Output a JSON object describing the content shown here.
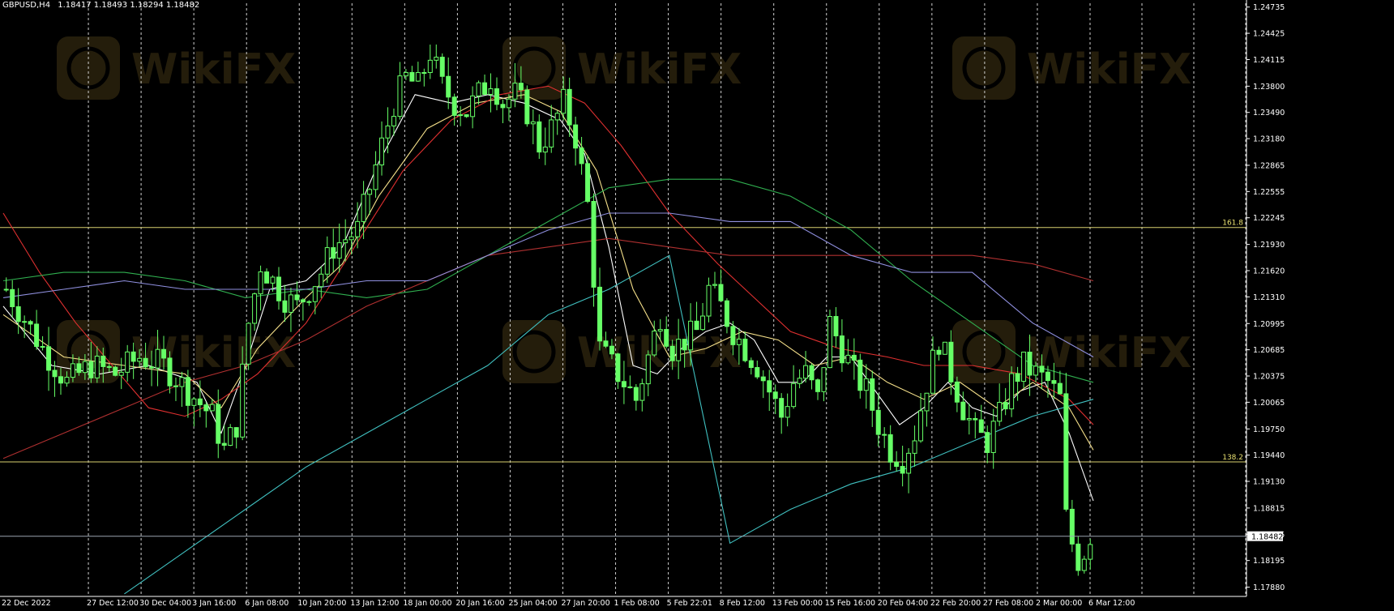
{
  "chart_data": {
    "type": "candlestick",
    "symbol": "GBPUSD,H4",
    "ohlc_readout": "1.18417 1.18493 1.18294 1.18482",
    "watermark": "WikiFX",
    "ylim": [
      1.1778,
      1.2478
    ],
    "y_ticks": [
      "1.24735",
      "1.24425",
      "1.24115",
      "1.23800",
      "1.23490",
      "1.23180",
      "1.22865",
      "1.22555",
      "1.22245",
      "1.21930",
      "1.21620",
      "1.21310",
      "1.20995",
      "1.20685",
      "1.20375",
      "1.20065",
      "1.19750",
      "1.19440",
      "1.19130",
      "1.18815",
      "1.18505",
      "1.18195",
      "1.17880"
    ],
    "x_ticks": [
      "22 Dec 2022",
      "27 Dec 12:00",
      "30 Dec 04:00",
      "3 Jan 16:00",
      "6 Jan 08:00",
      "10 Jan 20:00",
      "13 Jan 12:00",
      "18 Jan 00:00",
      "20 Jan 16:00",
      "25 Jan 04:00",
      "27 Jan 20:00",
      "1 Feb 08:00",
      "5 Feb 22:01",
      "8 Feb 12:00",
      "13 Feb 00:00",
      "15 Feb 16:00",
      "20 Feb 04:00",
      "22 Feb 20:00",
      "27 Feb 08:00",
      "2 Mar 00:00",
      "6 Mar 12:00"
    ],
    "current_price": "1.18482",
    "fibo_levels": [
      {
        "label": "161.8",
        "value": 1.2213
      },
      {
        "label": "138.2",
        "value": 1.1936
      }
    ],
    "close_path": [
      [
        0,
        1.214
      ],
      [
        6,
        1.207
      ],
      [
        10,
        1.203
      ],
      [
        14,
        1.205
      ],
      [
        18,
        1.204
      ],
      [
        22,
        1.206
      ],
      [
        26,
        1.205
      ],
      [
        30,
        1.202
      ],
      [
        34,
        1.199
      ],
      [
        36,
        1.195
      ],
      [
        38,
        1.198
      ],
      [
        40,
        1.21
      ],
      [
        42,
        1.217
      ],
      [
        44,
        1.215
      ],
      [
        46,
        1.213
      ],
      [
        48,
        1.212
      ],
      [
        50,
        1.214
      ],
      [
        52,
        1.216
      ],
      [
        54,
        1.219
      ],
      [
        56,
        1.22
      ],
      [
        58,
        1.221
      ],
      [
        60,
        1.226
      ],
      [
        62,
        1.231
      ],
      [
        64,
        1.236
      ],
      [
        66,
        1.239
      ],
      [
        68,
        1.238
      ],
      [
        70,
        1.242
      ],
      [
        72,
        1.238
      ],
      [
        74,
        1.236
      ],
      [
        76,
        1.235
      ],
      [
        78,
        1.237
      ],
      [
        80,
        1.239
      ],
      [
        82,
        1.236
      ],
      [
        84,
        1.237
      ],
      [
        86,
        1.235
      ],
      [
        88,
        1.231
      ],
      [
        90,
        1.233
      ],
      [
        92,
        1.236
      ],
      [
        94,
        1.232
      ],
      [
        96,
        1.224
      ],
      [
        98,
        1.207
      ],
      [
        100,
        1.205
      ],
      [
        102,
        1.203
      ],
      [
        104,
        1.201
      ],
      [
        106,
        1.206
      ],
      [
        108,
        1.211
      ],
      [
        110,
        1.207
      ],
      [
        112,
        1.208
      ],
      [
        114,
        1.209
      ],
      [
        116,
        1.214
      ],
      [
        118,
        1.212
      ],
      [
        120,
        1.209
      ],
      [
        122,
        1.207
      ],
      [
        124,
        1.205
      ],
      [
        126,
        1.202
      ],
      [
        128,
        1.199
      ],
      [
        130,
        1.203
      ],
      [
        132,
        1.204
      ],
      [
        134,
        1.201
      ],
      [
        136,
        1.21
      ],
      [
        138,
        1.207
      ],
      [
        140,
        1.204
      ],
      [
        142,
        1.202
      ],
      [
        144,
        1.198
      ],
      [
        146,
        1.195
      ],
      [
        148,
        1.194
      ],
      [
        150,
        1.197
      ],
      [
        152,
        1.203
      ],
      [
        154,
        1.208
      ],
      [
        156,
        1.204
      ],
      [
        158,
        1.2
      ],
      [
        160,
        1.197
      ],
      [
        162,
        1.196
      ],
      [
        164,
        1.199
      ],
      [
        166,
        1.203
      ],
      [
        168,
        1.205
      ],
      [
        170,
        1.204
      ],
      [
        172,
        1.203
      ],
      [
        174,
        1.201
      ],
      [
        175,
        1.187
      ],
      [
        176,
        1.184
      ],
      [
        177,
        1.182
      ],
      [
        178,
        1.183
      ],
      [
        179,
        1.185
      ]
    ],
    "ma_lines": [
      {
        "color": "#ffffff",
        "points": [
          [
            0,
            1.212
          ],
          [
            8,
            1.205
          ],
          [
            16,
            1.204
          ],
          [
            24,
            1.205
          ],
          [
            32,
            1.203
          ],
          [
            36,
            1.197
          ],
          [
            40,
            1.205
          ],
          [
            44,
            1.214
          ],
          [
            50,
            1.215
          ],
          [
            56,
            1.219
          ],
          [
            62,
            1.229
          ],
          [
            68,
            1.237
          ],
          [
            74,
            1.236
          ],
          [
            80,
            1.237
          ],
          [
            86,
            1.236
          ],
          [
            92,
            1.234
          ],
          [
            96,
            1.23
          ],
          [
            100,
            1.219
          ],
          [
            104,
            1.205
          ],
          [
            108,
            1.204
          ],
          [
            112,
            1.207
          ],
          [
            116,
            1.209
          ],
          [
            120,
            1.21
          ],
          [
            124,
            1.208
          ],
          [
            128,
            1.203
          ],
          [
            132,
            1.203
          ],
          [
            136,
            1.206
          ],
          [
            140,
            1.206
          ],
          [
            144,
            1.202
          ],
          [
            148,
            1.198
          ],
          [
            152,
            1.2
          ],
          [
            156,
            1.203
          ],
          [
            160,
            1.2
          ],
          [
            164,
            1.199
          ],
          [
            168,
            1.202
          ],
          [
            172,
            1.203
          ],
          [
            176,
            1.197
          ],
          [
            180,
            1.189
          ]
        ]
      },
      {
        "color": "#f5e08a",
        "points": [
          [
            0,
            1.211
          ],
          [
            10,
            1.206
          ],
          [
            20,
            1.205
          ],
          [
            30,
            1.204
          ],
          [
            36,
            1.2
          ],
          [
            42,
            1.207
          ],
          [
            50,
            1.213
          ],
          [
            56,
            1.217
          ],
          [
            62,
            1.225
          ],
          [
            70,
            1.233
          ],
          [
            78,
            1.236
          ],
          [
            86,
            1.237
          ],
          [
            92,
            1.235
          ],
          [
            98,
            1.228
          ],
          [
            104,
            1.214
          ],
          [
            110,
            1.206
          ],
          [
            116,
            1.207
          ],
          [
            122,
            1.209
          ],
          [
            128,
            1.208
          ],
          [
            134,
            1.205
          ],
          [
            140,
            1.206
          ],
          [
            146,
            1.203
          ],
          [
            152,
            1.201
          ],
          [
            158,
            1.203
          ],
          [
            164,
            1.2
          ],
          [
            170,
            1.203
          ],
          [
            176,
            1.2
          ],
          [
            180,
            1.195
          ]
        ]
      },
      {
        "color": "#e03030",
        "points": [
          [
            0,
            1.223
          ],
          [
            6,
            1.216
          ],
          [
            12,
            1.21
          ],
          [
            18,
            1.205
          ],
          [
            24,
            1.2
          ],
          [
            30,
            1.199
          ],
          [
            36,
            1.201
          ],
          [
            42,
            1.204
          ],
          [
            50,
            1.21
          ],
          [
            58,
            1.219
          ],
          [
            66,
            1.228
          ],
          [
            74,
            1.234
          ],
          [
            82,
            1.237
          ],
          [
            90,
            1.238
          ],
          [
            96,
            1.236
          ],
          [
            102,
            1.231
          ],
          [
            110,
            1.223
          ],
          [
            118,
            1.217
          ],
          [
            124,
            1.213
          ],
          [
            130,
            1.209
          ],
          [
            138,
            1.207
          ],
          [
            146,
            1.206
          ],
          [
            152,
            1.205
          ],
          [
            160,
            1.205
          ],
          [
            168,
            1.204
          ],
          [
            176,
            1.201
          ],
          [
            180,
            1.198
          ]
        ]
      },
      {
        "color": "#30b050",
        "points": [
          [
            0,
            1.215
          ],
          [
            10,
            1.216
          ],
          [
            20,
            1.216
          ],
          [
            30,
            1.215
          ],
          [
            40,
            1.213
          ],
          [
            50,
            1.214
          ],
          [
            60,
            1.213
          ],
          [
            70,
            1.214
          ],
          [
            80,
            1.218
          ],
          [
            90,
            1.222
          ],
          [
            100,
            1.226
          ],
          [
            110,
            1.227
          ],
          [
            120,
            1.227
          ],
          [
            130,
            1.225
          ],
          [
            140,
            1.221
          ],
          [
            150,
            1.215
          ],
          [
            160,
            1.21
          ],
          [
            170,
            1.205
          ],
          [
            180,
            1.203
          ]
        ]
      },
      {
        "color": "#b03030",
        "points": [
          [
            0,
            1.194
          ],
          [
            10,
            1.197
          ],
          [
            20,
            1.2
          ],
          [
            30,
            1.203
          ],
          [
            40,
            1.205
          ],
          [
            50,
            1.208
          ],
          [
            60,
            1.212
          ],
          [
            70,
            1.215
          ],
          [
            80,
            1.218
          ],
          [
            90,
            1.219
          ],
          [
            100,
            1.22
          ],
          [
            110,
            1.219
          ],
          [
            120,
            1.218
          ],
          [
            130,
            1.218
          ],
          [
            140,
            1.218
          ],
          [
            150,
            1.218
          ],
          [
            160,
            1.218
          ],
          [
            170,
            1.217
          ],
          [
            180,
            1.215
          ]
        ]
      },
      {
        "color": "#9090e0",
        "points": [
          [
            0,
            1.213
          ],
          [
            10,
            1.214
          ],
          [
            20,
            1.215
          ],
          [
            30,
            1.214
          ],
          [
            40,
            1.214
          ],
          [
            50,
            1.214
          ],
          [
            60,
            1.215
          ],
          [
            70,
            1.215
          ],
          [
            80,
            1.218
          ],
          [
            90,
            1.221
          ],
          [
            100,
            1.223
          ],
          [
            110,
            1.223
          ],
          [
            120,
            1.222
          ],
          [
            130,
            1.222
          ],
          [
            140,
            1.218
          ],
          [
            150,
            1.216
          ],
          [
            160,
            1.216
          ],
          [
            170,
            1.21
          ],
          [
            180,
            1.206
          ]
        ]
      },
      {
        "color": "#40c0c0",
        "points": [
          [
            20,
            1.178
          ],
          [
            30,
            1.183
          ],
          [
            40,
            1.188
          ],
          [
            50,
            1.193
          ],
          [
            60,
            1.197
          ],
          [
            70,
            1.201
          ],
          [
            80,
            1.205
          ],
          [
            90,
            1.211
          ],
          [
            100,
            1.214
          ],
          [
            110,
            1.218
          ],
          [
            120,
            1.184
          ],
          [
            130,
            1.188
          ],
          [
            140,
            1.191
          ],
          [
            150,
            1.193
          ],
          [
            160,
            1.196
          ],
          [
            170,
            1.199
          ],
          [
            180,
            1.201
          ]
        ]
      }
    ]
  }
}
